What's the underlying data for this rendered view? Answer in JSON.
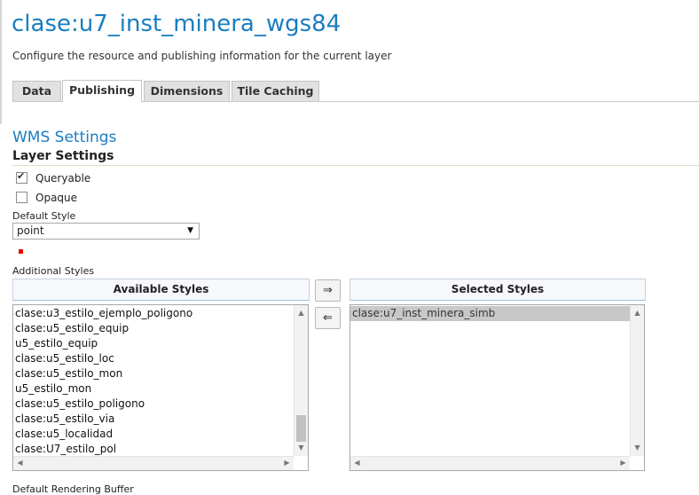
{
  "page": {
    "title": "clase:u7_inst_minera_wgs84",
    "description": "Configure the resource and publishing information for the current layer"
  },
  "tabs": [
    {
      "label": "Data",
      "active": false
    },
    {
      "label": "Publishing",
      "active": true
    },
    {
      "label": "Dimensions",
      "active": false
    },
    {
      "label": "Tile Caching",
      "active": false
    }
  ],
  "wms": {
    "section_title": "WMS Settings",
    "layer_settings_title": "Layer Settings",
    "queryable": {
      "label": "Queryable",
      "checked": true
    },
    "opaque": {
      "label": "Opaque",
      "checked": false
    },
    "default_style_label": "Default Style",
    "default_style_value": "point",
    "additional_styles_label": "Additional Styles",
    "available_styles_title": "Available Styles",
    "selected_styles_title": "Selected Styles",
    "available_styles": [
      "clase:u3_estilo_ejemplo_poligono",
      "clase:u5_estilo_equip",
      "u5_estilo_equip",
      "clase:u5_estilo_loc",
      "clase:u5_estilo_mon",
      "u5_estilo_mon",
      "clase:u5_estilo_poligono",
      "clase:u5_estilo_via",
      "clase:u5_localidad",
      "clase:U7_estilo_pol"
    ],
    "selected_styles": [
      "clase:u7_inst_minera_simb"
    ],
    "move_right_label": "⇒",
    "move_left_label": "⇐",
    "default_rendering_buffer_label": "Default Rendering Buffer"
  },
  "icons": {
    "check": "check-icon",
    "dropdown": "chevron-down-icon",
    "scroll_up": "scroll-up-arrow-icon",
    "scroll_down": "scroll-down-arrow-icon",
    "scroll_left": "scroll-left-arrow-icon",
    "scroll_right": "scroll-right-arrow-icon"
  },
  "colors": {
    "title_blue": "#1a7dc0",
    "style_swatch": "#e00000"
  }
}
